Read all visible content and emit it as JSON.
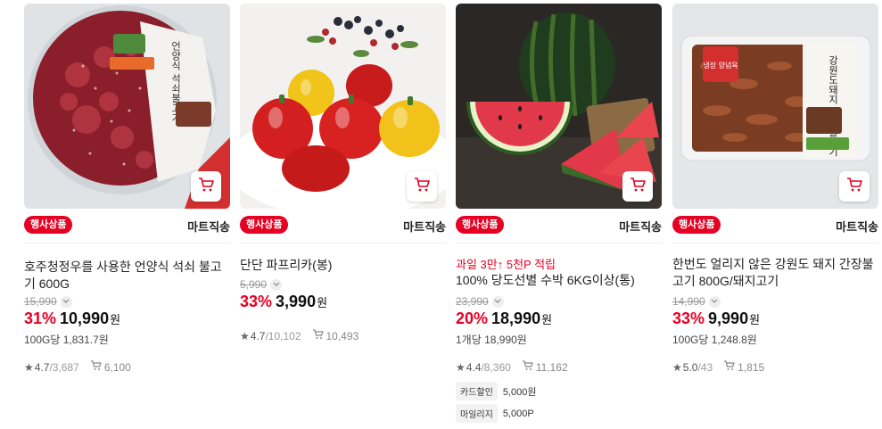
{
  "icons": {
    "cart": "shopping-cart-icon",
    "chevron": "chevron-down-icon",
    "star": "star-icon",
    "cart_stat": "cart-count-icon"
  },
  "colors": {
    "accent": "#e60023"
  },
  "products": [
    {
      "badge": "행사상품",
      "shipping": "마트직송",
      "name": "호주청정우를 사용한 언양식 석쇠 불고기 600G",
      "original_price": "15,990",
      "discount": "31%",
      "price": "10,990",
      "won": "원",
      "unit_price": "100G당 1,831.7원",
      "rating": "4.7",
      "review_count": "/3,687",
      "cart_count": "6,100",
      "image_label": "언양식 석쇠불고기"
    },
    {
      "badge": "행사상품",
      "shipping": "마트직송",
      "name": "단단 파프리카(봉)",
      "original_price": "5,990",
      "discount": "33%",
      "price": "3,990",
      "won": "원",
      "rating": "4.7",
      "review_count": "/10,102",
      "cart_count": "10,493"
    },
    {
      "badge": "행사상품",
      "shipping": "마트직송",
      "promo": "과일 3만↑ 5천P 적립",
      "name": "100% 당도선별 수박 6KG이상(통)",
      "original_price": "23,990",
      "discount": "20%",
      "price": "18,990",
      "won": "원",
      "unit_price": "1개당 18,990원",
      "rating": "4.4",
      "review_count": "/8,360",
      "cart_count": "11,162",
      "benefits": [
        {
          "tag": "카드할인",
          "value": "5,000원"
        },
        {
          "tag": "마일리지",
          "value": "5,000P"
        }
      ]
    },
    {
      "badge": "행사상품",
      "shipping": "마트직송",
      "name": "한번도 얼리지 않은 강원도 돼지 간장불고기 800G/돼지고기",
      "original_price": "14,990",
      "discount": "33%",
      "price": "9,990",
      "won": "원",
      "unit_price": "100G당 1,248.8원",
      "rating": "5.0",
      "review_count": "/43",
      "cart_count": "1,815",
      "image_label": "강원도돼지 간장불고기",
      "image_tag": "냉장 양념육"
    }
  ]
}
